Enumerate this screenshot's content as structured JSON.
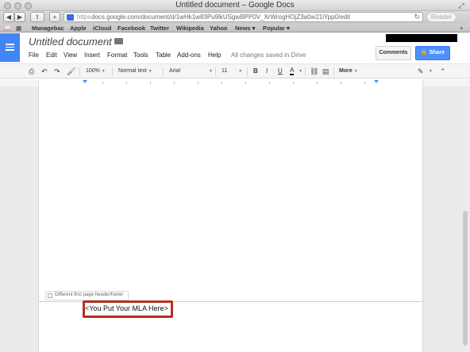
{
  "window": {
    "title": "Untitled document – Google Docs"
  },
  "browser": {
    "url_scheme": "https",
    "url": "docs.google.com/document/d/1wHk1w83Pu9lkUSgwBPP0V_XrWrogHOjZ3a0w21iYpp0/edit",
    "reader_label": "Reader",
    "nav_back": "◀",
    "nav_forward": "▶",
    "share_icon_glyph": "⇪",
    "add_glyph": "+",
    "reload_glyph": "↻",
    "bookmarks": [
      "Managebac",
      "Apple",
      "iCloud",
      "Facebook",
      "Twitter",
      "Wikipedia",
      "Yahoo",
      "News ▾",
      "Popular ▾"
    ]
  },
  "docs": {
    "doc_title": "Untitled document",
    "menus": [
      "File",
      "Edit",
      "View",
      "Insert",
      "Format",
      "Tools",
      "Table",
      "Add-ons",
      "Help"
    ],
    "save_status": "All changes saved in Drive",
    "comments_label": "Comments",
    "share_label": "Share",
    "accent": "#4285f4"
  },
  "editor_toolbar": {
    "zoom": "100%",
    "style": "Normal text",
    "font": "Arial",
    "size": "11",
    "bold": "B",
    "italic": "I",
    "underline": "U",
    "text_color": "A",
    "more": "More"
  },
  "footer": {
    "first_page_option": "Different first page header/footer",
    "content": "<You Put Your MLA Here>",
    "highlight_color": "#b5301f"
  }
}
